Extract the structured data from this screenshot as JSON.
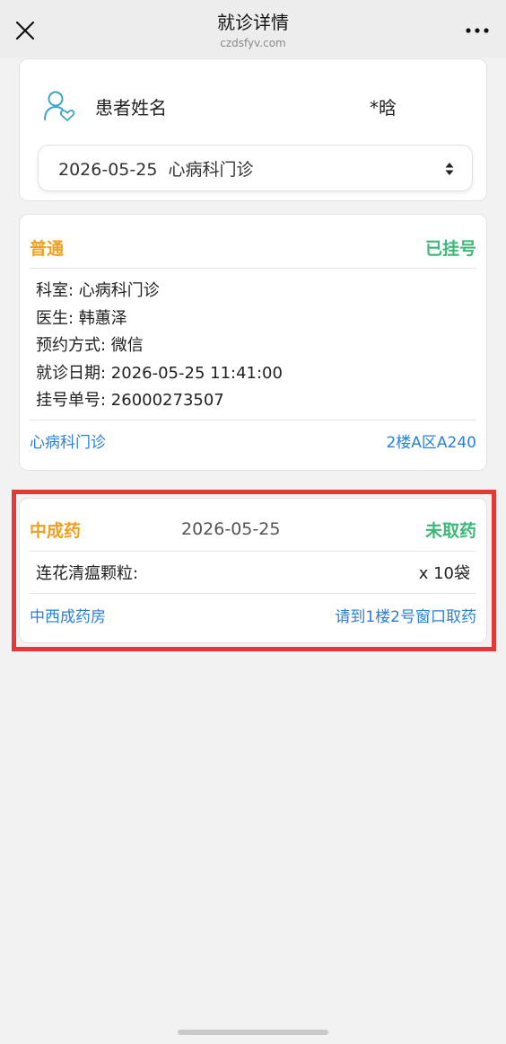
{
  "nav": {
    "title": "就诊详情",
    "subtitle": "czdsfyv.com"
  },
  "patient": {
    "label": "患者姓名",
    "name": "*晗",
    "visit_select": "2026-05-25  心病科门诊"
  },
  "registration": {
    "type": "普通",
    "status": "已挂号",
    "details": [
      "科室: 心病科门诊",
      "医生: 韩蕙泽",
      "预约方式: 微信",
      "就诊日期: 2026-05-25 11:41:00",
      "挂号单号: 26000273507"
    ],
    "footer_dept": "心病科门诊",
    "footer_location": "2楼A区A240"
  },
  "medicine": {
    "type": "中成药",
    "date": "2026-05-25",
    "status": "未取药",
    "item_name": "连花清瘟颗粒:",
    "item_qty": "x 10袋",
    "footer_pharmacy": "中西成药房",
    "footer_instruction": "请到1楼2号窗口取药"
  },
  "icons": {
    "close": "close-icon",
    "more": "more-icon",
    "avatar": "patient-heart-icon",
    "select_arrows": "sort-arrows-icon"
  },
  "colors": {
    "type_orange": "#f0a020",
    "status_green": "#3cb878",
    "link_blue": "#2a7fd6",
    "highlight_red": "#e53935",
    "avatar_teal": "#3aa5c8"
  }
}
